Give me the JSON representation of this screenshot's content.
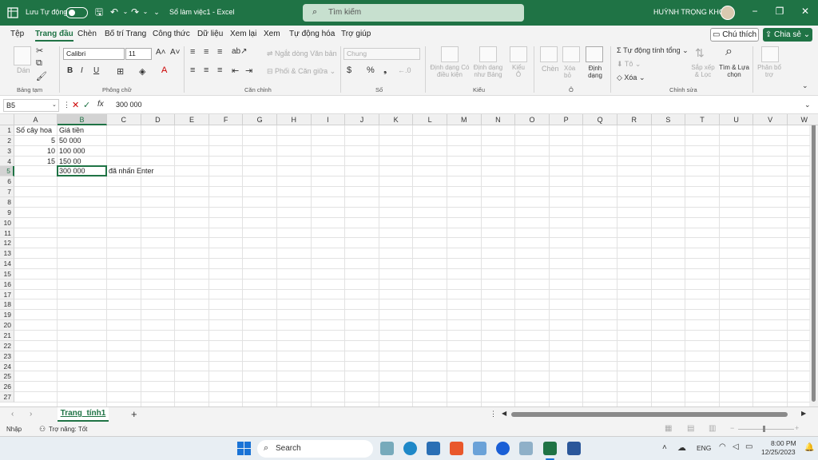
{
  "titlebar": {
    "autosave_label": "Lưu Tự động",
    "doc_title": "Sổ làm việc1  -  Excel",
    "search_placeholder": "Tìm kiếm",
    "user_name": "HUỲNH TRỌNG KHOA"
  },
  "menu": {
    "items": [
      "Tệp",
      "Trang đầu",
      "Chèn",
      "Bố trí Trang",
      "Công thức",
      "Dữ liệu",
      "Xem lại",
      "Xem",
      "Tự động hóa",
      "Trợ giúp"
    ],
    "active": "Trang đầu",
    "comment_label": "Chú thích",
    "share_label": "Chia sẻ"
  },
  "ribbon": {
    "paste_label": "Dán",
    "clipboard_label": "Bảng tạm",
    "font_name": "Calibri",
    "font_size": "11",
    "font_group_label": "Phông chữ",
    "wrap_text_label": "Ngắt dòng Văn bản",
    "merge_label": "Phối & Căn giữa",
    "alignment_label": "Căn chỉnh",
    "number_format": "Chung",
    "number_label": "Số",
    "conditional_format_label": "Định dạng Có điều kiện",
    "format_table_label": "Định dạng như Bảng",
    "cell_styles_label": "Kiểu Ô",
    "styles_group_label": "Kiểu",
    "insert_label": "Chèn",
    "delete_label": "Xóa bỏ",
    "format_label": "Định dạng",
    "cells_group_label": "Ô",
    "autosum_label": "Tự động tính tổng",
    "fill_label": "Tô",
    "clear_label": "Xóa",
    "sort_filter_label": "Sắp xếp & Lọc",
    "find_select_label": "Tìm & Lựa chọn",
    "editing_group_label": "Chỉnh sửa",
    "analysis_label": "Phân bổ trợ"
  },
  "formula": {
    "name_box": "B5",
    "content": "300 000"
  },
  "grid": {
    "columns": [
      "A",
      "B",
      "C",
      "D",
      "E",
      "F",
      "G",
      "H",
      "I",
      "J",
      "K",
      "L",
      "M",
      "N",
      "O",
      "P",
      "Q",
      "R",
      "S",
      "T",
      "U",
      "V",
      "W"
    ],
    "selected_column": "B",
    "rows": [
      "1",
      "2",
      "3",
      "4",
      "5",
      "6",
      "7",
      "8",
      "9",
      "10",
      "11",
      "12",
      "13",
      "14",
      "15",
      "16",
      "17",
      "18",
      "19",
      "20",
      "21",
      "22",
      "23",
      "24",
      "25",
      "26",
      "27"
    ],
    "selected_row": "5",
    "cells": {
      "A1": "Số cây hoa",
      "B1": "Giá tiền",
      "A2": "5",
      "B2": "50 000",
      "A3": "10",
      "B3": "100 000",
      "A4": "15",
      "B4": "150 00",
      "B5": "300 000",
      "C5": "đã nhấn Enter"
    }
  },
  "sheets": {
    "active_tab": "Trang_tính1"
  },
  "status": {
    "mode": "Nhập",
    "accessibility": "Trợ năng: Tốt"
  },
  "taskbar": {
    "search_label": "Search",
    "language": "ENG",
    "time": "8:00 PM",
    "date": "12/25/2023"
  }
}
